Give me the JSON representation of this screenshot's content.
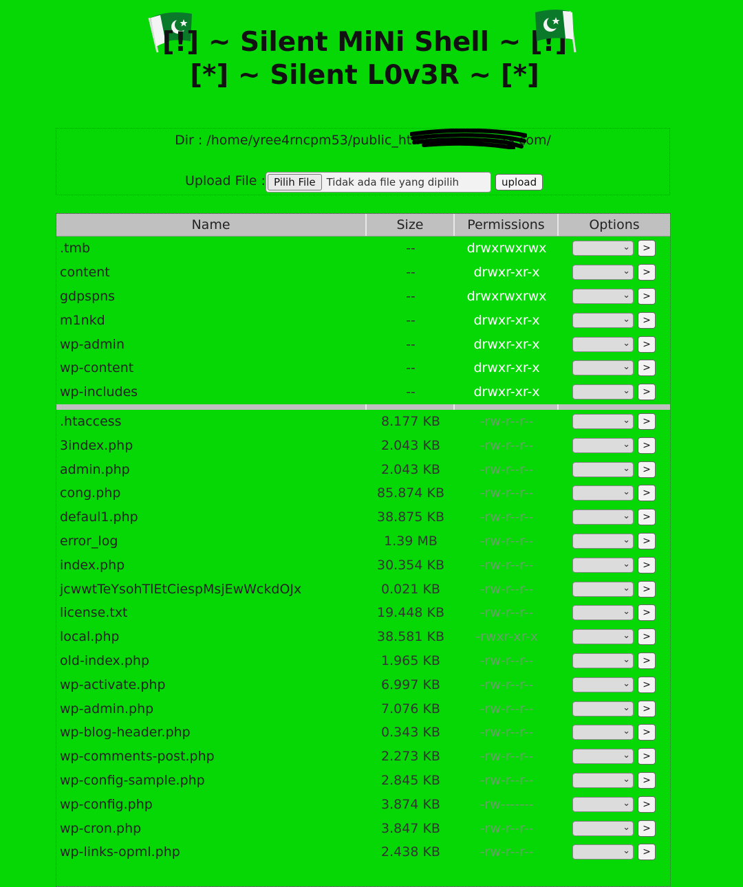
{
  "header": {
    "title1": "[!] ~ Silent MiNi Shell ~ [!]",
    "title2": "[*] ~ Silent L0v3R ~ [*]"
  },
  "dir": {
    "label": "Dir : ",
    "path": "/home/yree4rncpm53/public_html/",
    "path_tail": "ts.com/"
  },
  "upload": {
    "label": "Upload File : ",
    "pick_label": "Pilih File",
    "no_file": "Tidak ada file yang dipilih",
    "button": "upload"
  },
  "table": {
    "headers": [
      "Name",
      "Size",
      "Permissions",
      "Options"
    ],
    "go_label": ">",
    "dirs": [
      {
        "name": ".tmb",
        "size": "--",
        "perm": "drwxrwxrwx"
      },
      {
        "name": "content",
        "size": "--",
        "perm": "drwxr-xr-x"
      },
      {
        "name": "gdpspns",
        "size": "--",
        "perm": "drwxrwxrwx"
      },
      {
        "name": "m1nkd",
        "size": "--",
        "perm": "drwxr-xr-x"
      },
      {
        "name": "wp-admin",
        "size": "--",
        "perm": "drwxr-xr-x"
      },
      {
        "name": "wp-content",
        "size": "--",
        "perm": "drwxr-xr-x"
      },
      {
        "name": "wp-includes",
        "size": "--",
        "perm": "drwxr-xr-x"
      }
    ],
    "files": [
      {
        "name": ".htaccess",
        "size": "8.177 KB",
        "perm": "-rw-r--r--"
      },
      {
        "name": "3index.php",
        "size": "2.043 KB",
        "perm": "-rw-r--r--"
      },
      {
        "name": "admin.php",
        "size": "2.043 KB",
        "perm": "-rw-r--r--"
      },
      {
        "name": "cong.php",
        "size": "85.874 KB",
        "perm": "-rw-r--r--"
      },
      {
        "name": "defaul1.php",
        "size": "38.875 KB",
        "perm": "-rw-r--r--"
      },
      {
        "name": "error_log",
        "size": "1.39 MB",
        "perm": "-rw-r--r--"
      },
      {
        "name": "index.php",
        "size": "30.354 KB",
        "perm": "-rw-r--r--"
      },
      {
        "name": "jcwwtTeYsohTlEtCiespMsjEwWckdOJx",
        "size": "0.021 KB",
        "perm": "-rw-r--r--"
      },
      {
        "name": "license.txt",
        "size": "19.448 KB",
        "perm": "-rw-r--r--"
      },
      {
        "name": "local.php",
        "size": "38.581 KB",
        "perm": "-rwxr-xr-x"
      },
      {
        "name": "old-index.php",
        "size": "1.965 KB",
        "perm": "-rw-r--r--"
      },
      {
        "name": "wp-activate.php",
        "size": "6.997 KB",
        "perm": "-rw-r--r--"
      },
      {
        "name": "wp-admin.php",
        "size": "7.076 KB",
        "perm": "-rw-r--r--"
      },
      {
        "name": "wp-blog-header.php",
        "size": "0.343 KB",
        "perm": "-rw-r--r--"
      },
      {
        "name": "wp-comments-post.php",
        "size": "2.273 KB",
        "perm": "-rw-r--r--"
      },
      {
        "name": "wp-config-sample.php",
        "size": "2.845 KB",
        "perm": "-rw-r--r--"
      },
      {
        "name": "wp-config.php",
        "size": "3.874 KB",
        "perm": "-rw-------"
      },
      {
        "name": "wp-cron.php",
        "size": "3.847 KB",
        "perm": "-rw-r--r--"
      },
      {
        "name": "wp-links-opml.php",
        "size": "2.438 KB",
        "perm": "-rw-r--r--"
      }
    ]
  },
  "colors": {
    "background": "#06d806",
    "header_row": "#c0c0c0",
    "dir_perm": "#ffffff",
    "file_perm": "#6b9e6b"
  },
  "icons": {
    "flag": "pakistan-flag-icon",
    "select_chevron": "chevron-down-icon"
  }
}
